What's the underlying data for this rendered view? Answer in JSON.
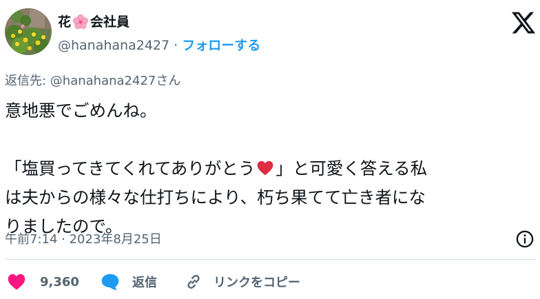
{
  "author": {
    "name_before": "花",
    "name_after": "会社員",
    "handle": "@hanahana2427",
    "separator": " · ",
    "follow_label": "フォローする"
  },
  "reply_to": {
    "prefix": "返信先: ",
    "handle": "@hanahana2427",
    "suffix": "さん"
  },
  "tweet": {
    "line1": "意地悪でごめんね。",
    "line2a": "「塩買ってきてくれてありがとう",
    "line2b": "」と可愛く答える私",
    "line3": "は夫からの様々な仕打ちにより、朽ち果てて亡き者にな",
    "line4": "りましたので。"
  },
  "meta": {
    "time": "午前7:14",
    "separator": " · ",
    "date": "2023年8月25日"
  },
  "actions": {
    "like_count": "9,360",
    "reply_label": "返信",
    "copy_label": "リンクをコピー"
  },
  "colors": {
    "text": "#0f1419",
    "secondary": "#536471",
    "link": "#1d9bf0",
    "like": "#f91880",
    "reply_icon": "#1d9bf0",
    "divider": "#cfd9de"
  },
  "icons": {
    "flower": "cherry-blossom-icon",
    "logo": "x-logo-icon",
    "heart": "red-heart-emoji",
    "info": "info-icon",
    "like": "heart-icon",
    "reply": "speech-bubble-icon",
    "link": "link-icon"
  }
}
